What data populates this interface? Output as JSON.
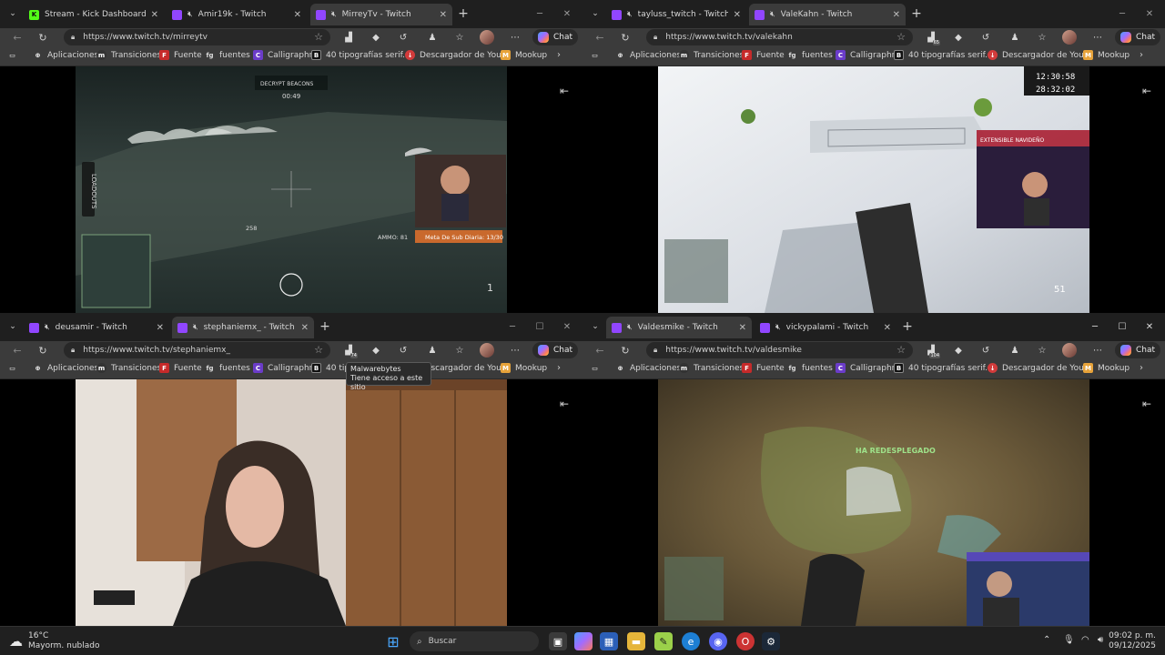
{
  "windows": [
    {
      "tabs": [
        {
          "title": "Stream - Kick Dashboard",
          "fav": "kick",
          "active": false,
          "muted": false
        },
        {
          "title": "Amir19k - Twitch",
          "fav": "twitch",
          "active": false,
          "muted": true
        },
        {
          "title": "MirreyTv - Twitch",
          "fav": "twitch",
          "active": true,
          "muted": true
        }
      ],
      "url": "https://www.twitch.tv/mirreytv",
      "ext_badge": ""
    },
    {
      "tabs": [
        {
          "title": "tayluss_twitch - Twitch",
          "fav": "twitch",
          "active": false,
          "muted": true
        },
        {
          "title": "ValeKahn - Twitch",
          "fav": "twitch",
          "active": true,
          "muted": true
        }
      ],
      "url": "https://www.twitch.tv/valekahn",
      "ext_badge": "65"
    },
    {
      "tabs": [
        {
          "title": "deusamir - Twitch",
          "fav": "twitch",
          "active": false,
          "muted": true
        },
        {
          "title": "stephaniemx_ - Twitch",
          "fav": "twitch",
          "active": true,
          "muted": true
        }
      ],
      "url": "https://www.twitch.tv/stephaniemx_",
      "ext_badge": "74"
    },
    {
      "tabs": [
        {
          "title": "Valdesmike - Twitch",
          "fav": "twitch",
          "active": true,
          "muted": true
        },
        {
          "title": "vickypalami - Twitch",
          "fav": "twitch",
          "active": false,
          "muted": true
        }
      ],
      "url": "https://www.twitch.tv/valdesmike",
      "ext_badge": "104"
    }
  ],
  "chat_label": "Chat",
  "bookmarks": [
    {
      "label": "Aplicaciones",
      "icon": "grid-icon"
    },
    {
      "label": "Transiciones",
      "icon": "m-icon"
    },
    {
      "label": "Fuente",
      "icon": "f-icon"
    },
    {
      "label": "fuentes",
      "icon": "fg-icon"
    },
    {
      "label": "Calligraphr",
      "icon": "calligraphr-icon"
    },
    {
      "label": "40 tipografías serif...",
      "icon": "b-icon"
    },
    {
      "label": "Descargador de You...",
      "icon": "download-icon"
    },
    {
      "label": "Mookup",
      "icon": "mookup-icon"
    }
  ],
  "tooltip": {
    "title": "Malwarebytes",
    "text": "Tiene acceso a este sitio"
  },
  "overlays": {
    "w1": {
      "beacons": "DECRYPT BEACONS",
      "timer": "00:49",
      "ammo": "AMMO: 81",
      "sub_goal": "Meta De Sub Diaria: 13/30",
      "count": "1",
      "loadouts": "LOADOUTS",
      "distance": "258"
    },
    "w2": {
      "clock1": "12:30:58",
      "clock2": "28:32:02",
      "banner": "EXTENSIBLE NAVIDEÑO",
      "ammo": "51"
    },
    "w4": {
      "redeploy": "HA REDESPLEGADO"
    }
  },
  "taskbar": {
    "temp": "16°C",
    "weather": "Mayorm. nublado",
    "search": "Buscar",
    "time": "09:02 p. m.",
    "date": "09/12/2025"
  }
}
